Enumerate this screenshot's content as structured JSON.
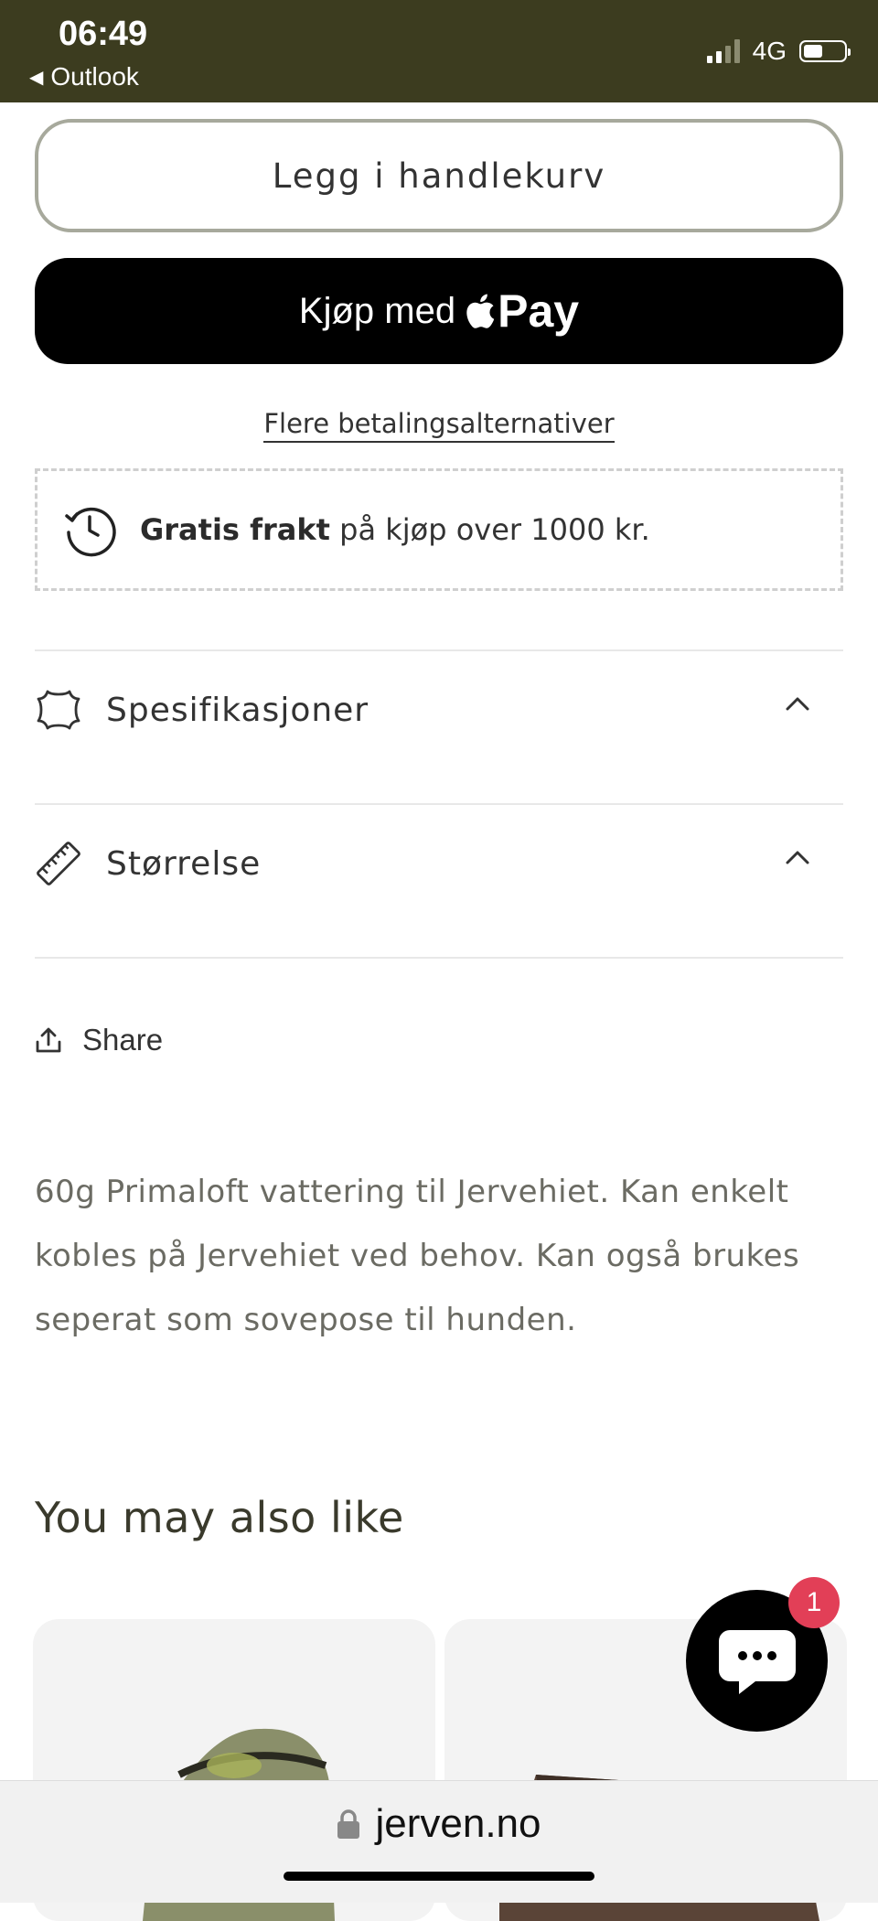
{
  "status_bar": {
    "time": "06:49",
    "back_app": "Outlook",
    "network": "4G",
    "background": "#3c3c1f"
  },
  "product": {
    "add_to_cart_label": "Legg i handlekurv",
    "apple_pay_prefix": "Kjøp med",
    "apple_pay_brand": "Pay",
    "more_payment_options": "Flere betalingsalternativer",
    "shipping": {
      "bold": "Gratis frakt",
      "text": "på kjøp over 1000 kr.",
      "icon": "clock-icon"
    },
    "accordions": [
      {
        "label": "Spesifikasjoner",
        "icon": "leather-icon"
      },
      {
        "label": "Størrelse",
        "icon": "ruler-icon"
      }
    ],
    "share_label": "Share",
    "description": "60g Primaloft vattering til Jervehiet. Kan enkelt kobles på Jervehiet ved behov. Kan også brukes seperat som sovepose til hunden."
  },
  "recommendations": {
    "heading": "You may also like"
  },
  "chat": {
    "badge_count": "1"
  },
  "browser": {
    "url": "jerven.no"
  }
}
